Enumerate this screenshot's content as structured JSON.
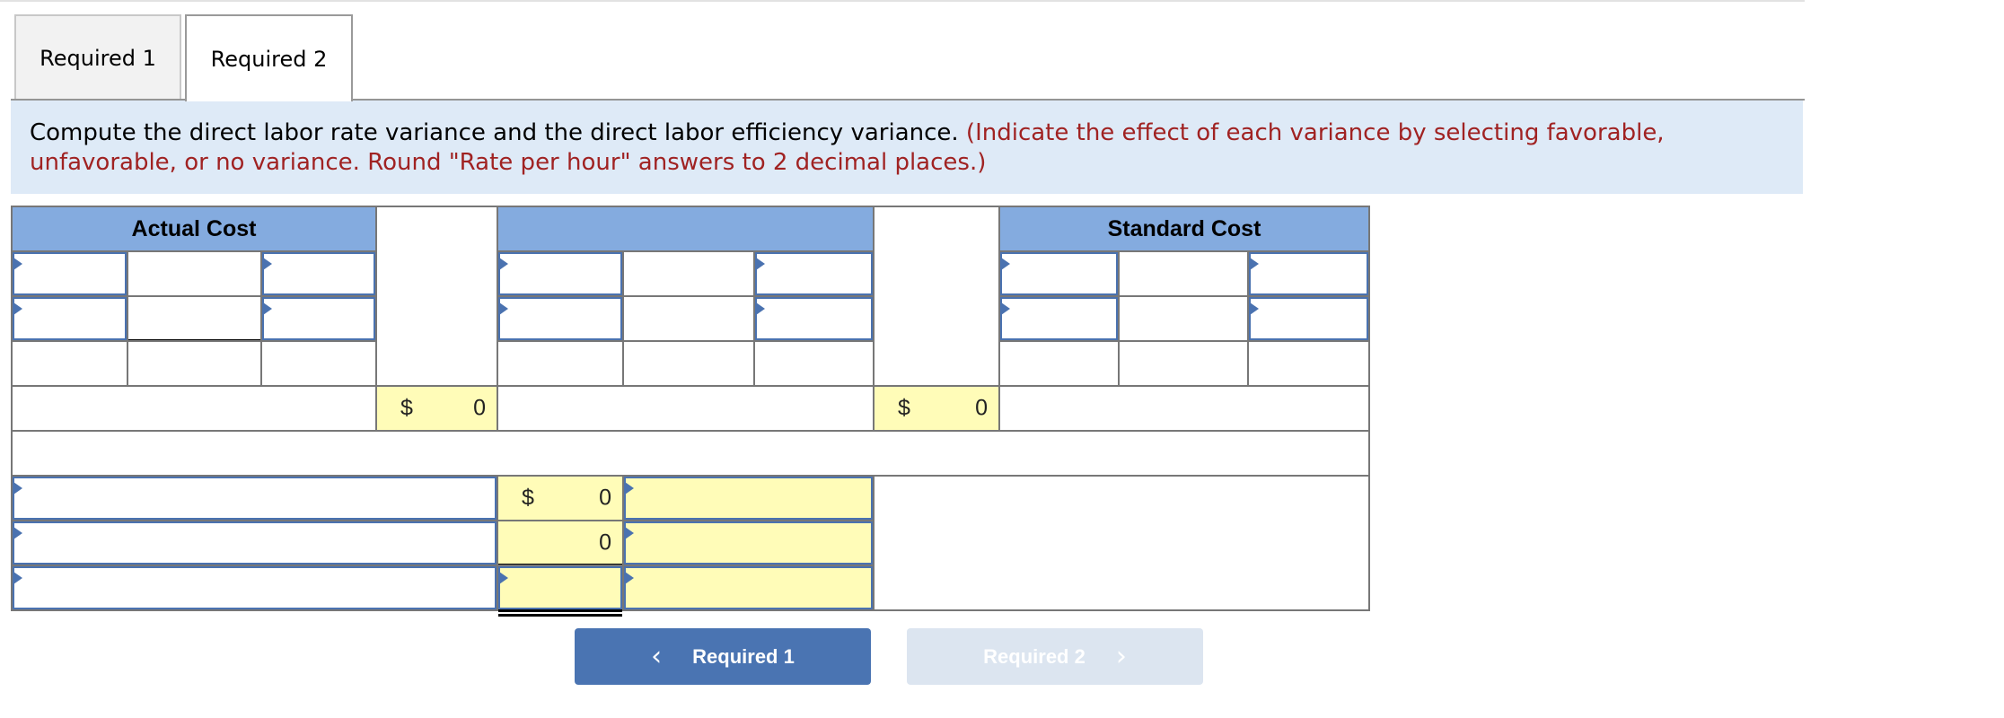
{
  "tabs": [
    {
      "label": "Required 1",
      "active": false
    },
    {
      "label": "Required 2",
      "active": true
    }
  ],
  "instructions": {
    "main": "Compute the direct labor rate variance and the direct labor efficiency variance.",
    "note": "(Indicate the effect of each variance by selecting favorable, unfavorable, or no variance. Round \"Rate per hour\" answers to 2 decimal places.)"
  },
  "table": {
    "headers": {
      "actual_cost": "Actual Cost",
      "middle": "",
      "standard_cost": "Standard Cost"
    },
    "totals": {
      "actual_currency": "$",
      "actual_value": "0",
      "middle_currency": "$",
      "middle_value": "0"
    },
    "variances": [
      {
        "label": "",
        "currency": "$",
        "value": "0",
        "effect": ""
      },
      {
        "label": "",
        "currency": "",
        "value": "0",
        "effect": ""
      },
      {
        "label": "",
        "currency": "",
        "value": "",
        "effect": ""
      }
    ]
  },
  "colors": {
    "header_blue": "#84abdf",
    "input_border": "#4a72b0",
    "computed_yellow": "#fffcb8",
    "instruction_bg": "#deeaf7",
    "note_red": "#a02222",
    "primary_button": "#4a74b2",
    "disabled_button": "#dce5f0"
  },
  "nav": {
    "prev_label": "Required 1",
    "prev_icon": "chevron-left-icon",
    "next_label": "Required 2",
    "next_icon": "chevron-right-icon",
    "next_disabled": true
  }
}
